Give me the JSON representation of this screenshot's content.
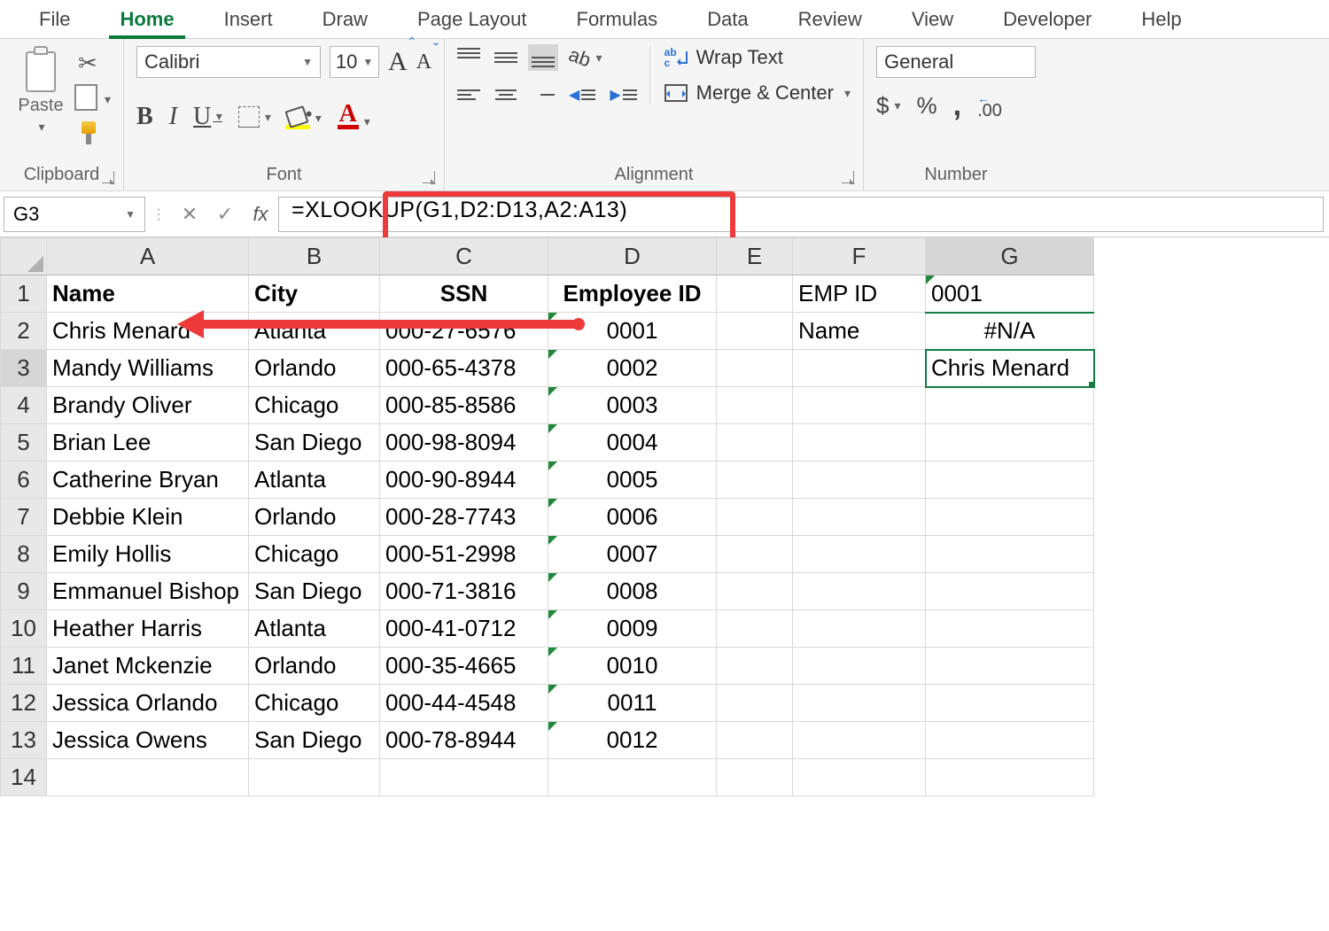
{
  "ribbon": {
    "tabs": [
      "File",
      "Home",
      "Insert",
      "Draw",
      "Page Layout",
      "Formulas",
      "Data",
      "Review",
      "View",
      "Developer",
      "Help"
    ],
    "active_tab": "Home",
    "groups": {
      "clipboard": {
        "label": "Clipboard",
        "paste": "Paste"
      },
      "font": {
        "label": "Font",
        "name": "Calibri",
        "size": "10",
        "bold": "B",
        "italic": "I",
        "underline": "U"
      },
      "alignment": {
        "label": "Alignment",
        "wrap": "Wrap Text",
        "merge": "Merge & Center"
      },
      "number": {
        "label": "Number",
        "format": "General",
        "currency": "$",
        "percent": "%",
        "comma": ","
      }
    }
  },
  "formula_bar": {
    "name_box": "G3",
    "fx": "fx",
    "formula": "=XLOOKUP(G1,D2:D13,A2:A13)"
  },
  "columns": [
    "A",
    "B",
    "C",
    "D",
    "E",
    "F",
    "G"
  ],
  "headers": {
    "A": "Name",
    "B": "City",
    "C": "SSN",
    "D": "Employee ID"
  },
  "side": {
    "F1": "EMP ID",
    "G1": "0001",
    "F2": "Name",
    "G2": "#N/A",
    "G3": "Chris Menard"
  },
  "rows": [
    {
      "n": "Chris Menard",
      "c": "Atlanta",
      "s": "000-27-6576",
      "e": "0001"
    },
    {
      "n": "Mandy Williams",
      "c": "Orlando",
      "s": "000-65-4378",
      "e": "0002"
    },
    {
      "n": "Brandy Oliver",
      "c": "Chicago",
      "s": "000-85-8586",
      "e": "0003"
    },
    {
      "n": "Brian Lee",
      "c": "San Diego",
      "s": "000-98-8094",
      "e": "0004"
    },
    {
      "n": "Catherine Bryan",
      "c": "Atlanta",
      "s": "000-90-8944",
      "e": "0005"
    },
    {
      "n": "Debbie Klein",
      "c": "Orlando",
      "s": "000-28-7743",
      "e": "0006"
    },
    {
      "n": "Emily Hollis",
      "c": "Chicago",
      "s": "000-51-2998",
      "e": "0007"
    },
    {
      "n": "Emmanuel Bishop",
      "c": "San Diego",
      "s": "000-71-3816",
      "e": "0008"
    },
    {
      "n": "Heather Harris",
      "c": "Atlanta",
      "s": "000-41-0712",
      "e": "0009"
    },
    {
      "n": "Janet Mckenzie",
      "c": "Orlando",
      "s": "000-35-4665",
      "e": "0010"
    },
    {
      "n": "Jessica Orlando",
      "c": "Chicago",
      "s": "000-44-4548",
      "e": "0011"
    },
    {
      "n": "Jessica Owens",
      "c": "San Diego",
      "s": "000-78-8944",
      "e": "0012"
    }
  ]
}
